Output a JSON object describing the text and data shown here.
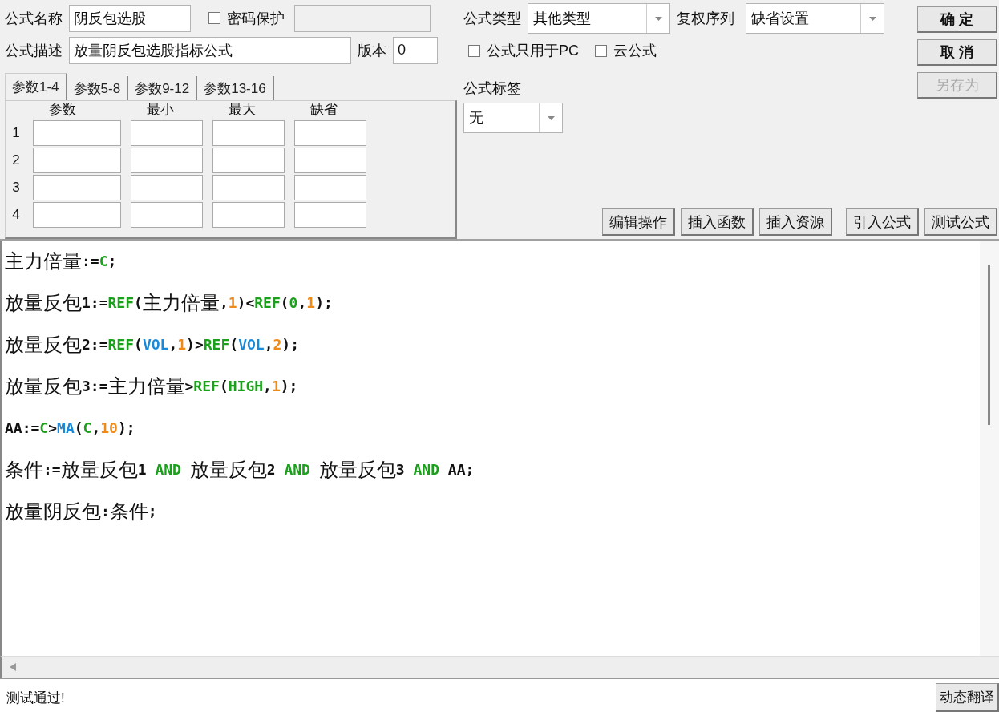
{
  "formula_name": {
    "label": "公式名称",
    "value": "阴反包选股"
  },
  "password": {
    "label": "密码保护",
    "checked": false
  },
  "description": {
    "label": "公式描述",
    "value": "放量阴反包选股指标公式"
  },
  "version": {
    "label": "版本",
    "value": "0"
  },
  "tabs": [
    {
      "label": "参数1-4",
      "selected": true
    },
    {
      "label": "参数5-8",
      "selected": false
    },
    {
      "label": "参数9-12",
      "selected": false
    },
    {
      "label": "参数13-16",
      "selected": false
    }
  ],
  "param_table": {
    "columns": [
      "参数",
      "最小",
      "最大",
      "缺省"
    ],
    "rows": [
      "1",
      "2",
      "3",
      "4"
    ]
  },
  "formula_type": {
    "label": "公式类型",
    "value": "其他类型"
  },
  "adjust_sequence": {
    "label": "复权序列",
    "value": "缺省设置"
  },
  "options": [
    {
      "label": "公式只用于PC",
      "checked": false
    },
    {
      "label": "云公式",
      "checked": false
    }
  ],
  "formula_tag": {
    "label": "公式标签",
    "value": "无"
  },
  "side_buttons": [
    {
      "label": "确 定",
      "disabled": false
    },
    {
      "label": "取 消",
      "disabled": false
    },
    {
      "label": "另存为",
      "disabled": true
    }
  ],
  "toolbar": [
    "编辑操作",
    "插入函数",
    "插入资源",
    "引入公式",
    "测试公式"
  ],
  "code_lines": [
    [
      {
        "text": "主力倍量",
        "kind": "name"
      },
      {
        "text": ":=",
        "kind": "op"
      },
      {
        "text": "C",
        "kind": "fn"
      },
      {
        "text": ";",
        "kind": "op"
      }
    ],
    [
      {
        "text": "放量反包",
        "kind": "name"
      },
      {
        "text": "1:=",
        "kind": "op"
      },
      {
        "text": "REF",
        "kind": "fn"
      },
      {
        "text": "(",
        "kind": "op"
      },
      {
        "text": "主力倍量",
        "kind": "name"
      },
      {
        "text": ",",
        "kind": "op"
      },
      {
        "text": "1",
        "kind": "num"
      },
      {
        "text": ")<",
        "kind": "op"
      },
      {
        "text": "REF",
        "kind": "fn"
      },
      {
        "text": "(",
        "kind": "op"
      },
      {
        "text": "0",
        "kind": "fn"
      },
      {
        "text": ",",
        "kind": "op"
      },
      {
        "text": "1",
        "kind": "num"
      },
      {
        "text": ");",
        "kind": "op"
      }
    ],
    [
      {
        "text": "放量反包",
        "kind": "name"
      },
      {
        "text": "2:=",
        "kind": "op"
      },
      {
        "text": "REF",
        "kind": "fn"
      },
      {
        "text": "(",
        "kind": "op"
      },
      {
        "text": "VOL",
        "kind": "var"
      },
      {
        "text": ",",
        "kind": "op"
      },
      {
        "text": "1",
        "kind": "num"
      },
      {
        "text": ")>",
        "kind": "op"
      },
      {
        "text": "REF",
        "kind": "fn"
      },
      {
        "text": "(",
        "kind": "op"
      },
      {
        "text": "VOL",
        "kind": "var"
      },
      {
        "text": ",",
        "kind": "op"
      },
      {
        "text": "2",
        "kind": "num"
      },
      {
        "text": ");",
        "kind": "op"
      }
    ],
    [
      {
        "text": "放量反包",
        "kind": "name"
      },
      {
        "text": "3:=",
        "kind": "op"
      },
      {
        "text": "主力倍量",
        "kind": "name"
      },
      {
        "text": ">",
        "kind": "op"
      },
      {
        "text": "REF",
        "kind": "fn"
      },
      {
        "text": "(",
        "kind": "op"
      },
      {
        "text": "HIGH",
        "kind": "fn"
      },
      {
        "text": ",",
        "kind": "op"
      },
      {
        "text": "1",
        "kind": "num"
      },
      {
        "text": ");",
        "kind": "op"
      }
    ],
    [
      {
        "text": "AA:=",
        "kind": "op"
      },
      {
        "text": "C",
        "kind": "fn"
      },
      {
        "text": ">",
        "kind": "op"
      },
      {
        "text": "MA",
        "kind": "var"
      },
      {
        "text": "(",
        "kind": "op"
      },
      {
        "text": "C",
        "kind": "fn"
      },
      {
        "text": ",",
        "kind": "op"
      },
      {
        "text": "10",
        "kind": "num"
      },
      {
        "text": ");",
        "kind": "op"
      }
    ],
    [
      {
        "text": "条件",
        "kind": "name"
      },
      {
        "text": ":=",
        "kind": "op"
      },
      {
        "text": "放量反包",
        "kind": "name"
      },
      {
        "text": "1 ",
        "kind": "op"
      },
      {
        "text": "AND ",
        "kind": "fn"
      },
      {
        "text": "放量反包",
        "kind": "name"
      },
      {
        "text": "2 ",
        "kind": "op"
      },
      {
        "text": "AND ",
        "kind": "fn"
      },
      {
        "text": "放量反包",
        "kind": "name"
      },
      {
        "text": "3 ",
        "kind": "op"
      },
      {
        "text": "AND ",
        "kind": "fn"
      },
      {
        "text": "AA;",
        "kind": "op"
      }
    ],
    [
      {
        "text": "放量阴反包",
        "kind": "name"
      },
      {
        "text": ":",
        "kind": "op"
      },
      {
        "text": "条件",
        "kind": "name"
      },
      {
        "text": ";",
        "kind": "op"
      }
    ]
  ],
  "status": {
    "message": "测试通过!",
    "button": "动态翻译"
  }
}
